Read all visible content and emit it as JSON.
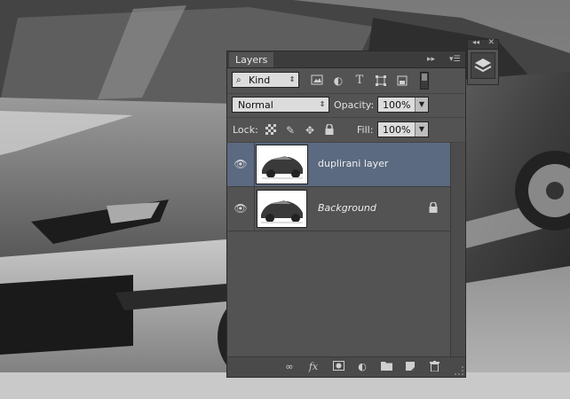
{
  "panel": {
    "tab_title": "Layers",
    "filter": {
      "label": "Kind"
    },
    "blend_mode": "Normal",
    "opacity": {
      "label": "Opacity:",
      "value": "100%"
    },
    "lock": {
      "label": "Lock:"
    },
    "fill": {
      "label": "Fill:",
      "value": "100%"
    },
    "layers": [
      {
        "name": "duplirani layer",
        "selected": true,
        "visible": true,
        "locked": false,
        "italic": false
      },
      {
        "name": "Background",
        "selected": false,
        "visible": true,
        "locked": true,
        "italic": true
      }
    ],
    "bottom_icons": [
      "link-layers-icon",
      "fx-icon",
      "add-mask-icon",
      "adjustment-layer-icon",
      "new-group-icon",
      "new-layer-icon",
      "delete-layer-icon"
    ]
  },
  "colors": {
    "panel_bg": "#535353",
    "selected_row": "#5b6a80",
    "titlebar": "#3c3c3c"
  }
}
